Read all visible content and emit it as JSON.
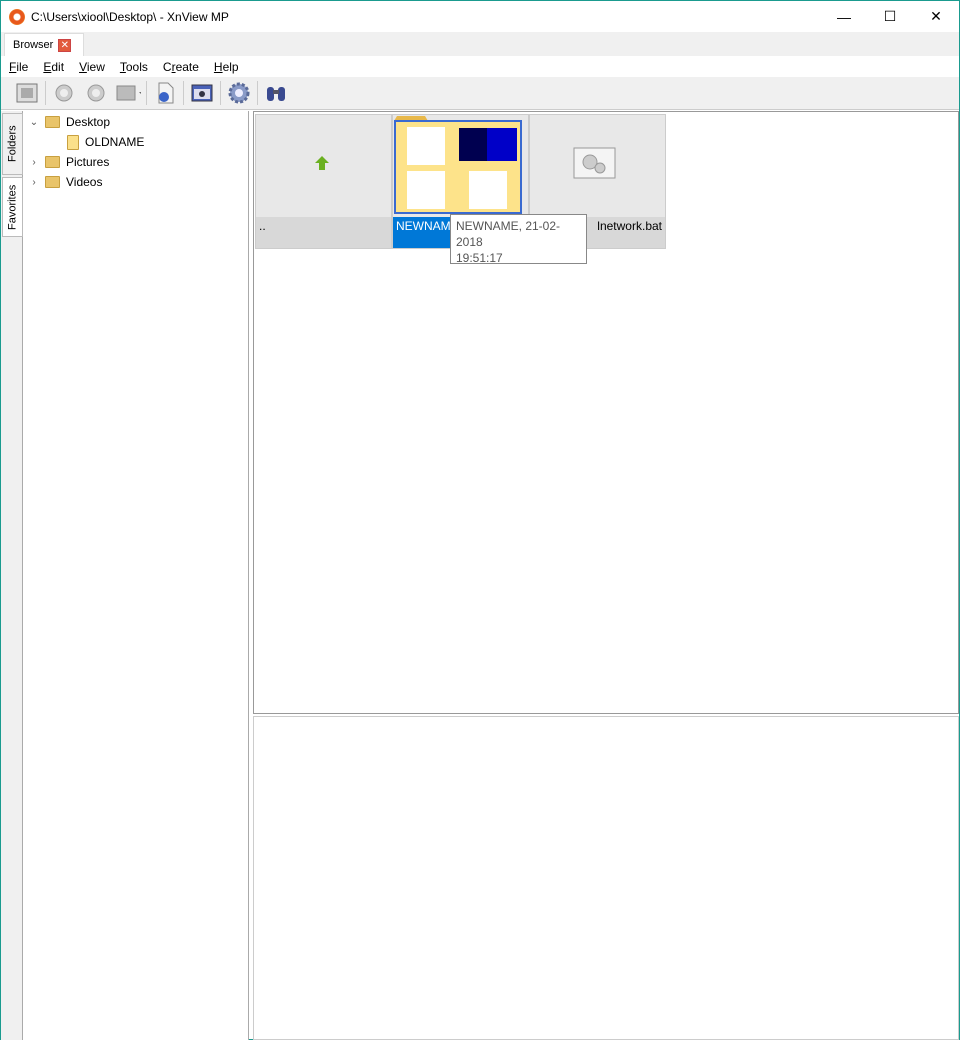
{
  "window": {
    "title": "C:\\Users\\xiool\\Desktop\\ - XnView MP",
    "minimize": "—",
    "maximize": "☐",
    "close": "✕"
  },
  "tabs": [
    {
      "label": "Browser",
      "close": "✕"
    }
  ],
  "menu": [
    {
      "pre": "",
      "u": "F",
      "post": "ile"
    },
    {
      "pre": "",
      "u": "E",
      "post": "dit"
    },
    {
      "pre": "",
      "u": "V",
      "post": "iew"
    },
    {
      "pre": "",
      "u": "T",
      "post": "ools"
    },
    {
      "pre": "C",
      "u": "r",
      "post": "eate"
    },
    {
      "pre": "",
      "u": "H",
      "post": "elp"
    }
  ],
  "side_tabs": [
    "Folders",
    "Favorites"
  ],
  "tree": [
    {
      "label": "Desktop",
      "chev": "⌄"
    },
    {
      "label": "OLDNAME",
      "chev": ""
    },
    {
      "label": "Pictures",
      "chev": "›"
    },
    {
      "label": "Videos",
      "chev": "›"
    }
  ],
  "thumbnails": [
    {
      "label": ".."
    },
    {
      "label": "NEWNAME"
    },
    {
      "label": "lnetwork.bat"
    }
  ],
  "tooltip": {
    "line1": "NEWNAME, 21-02-2018",
    "line2": "19:51:17"
  }
}
